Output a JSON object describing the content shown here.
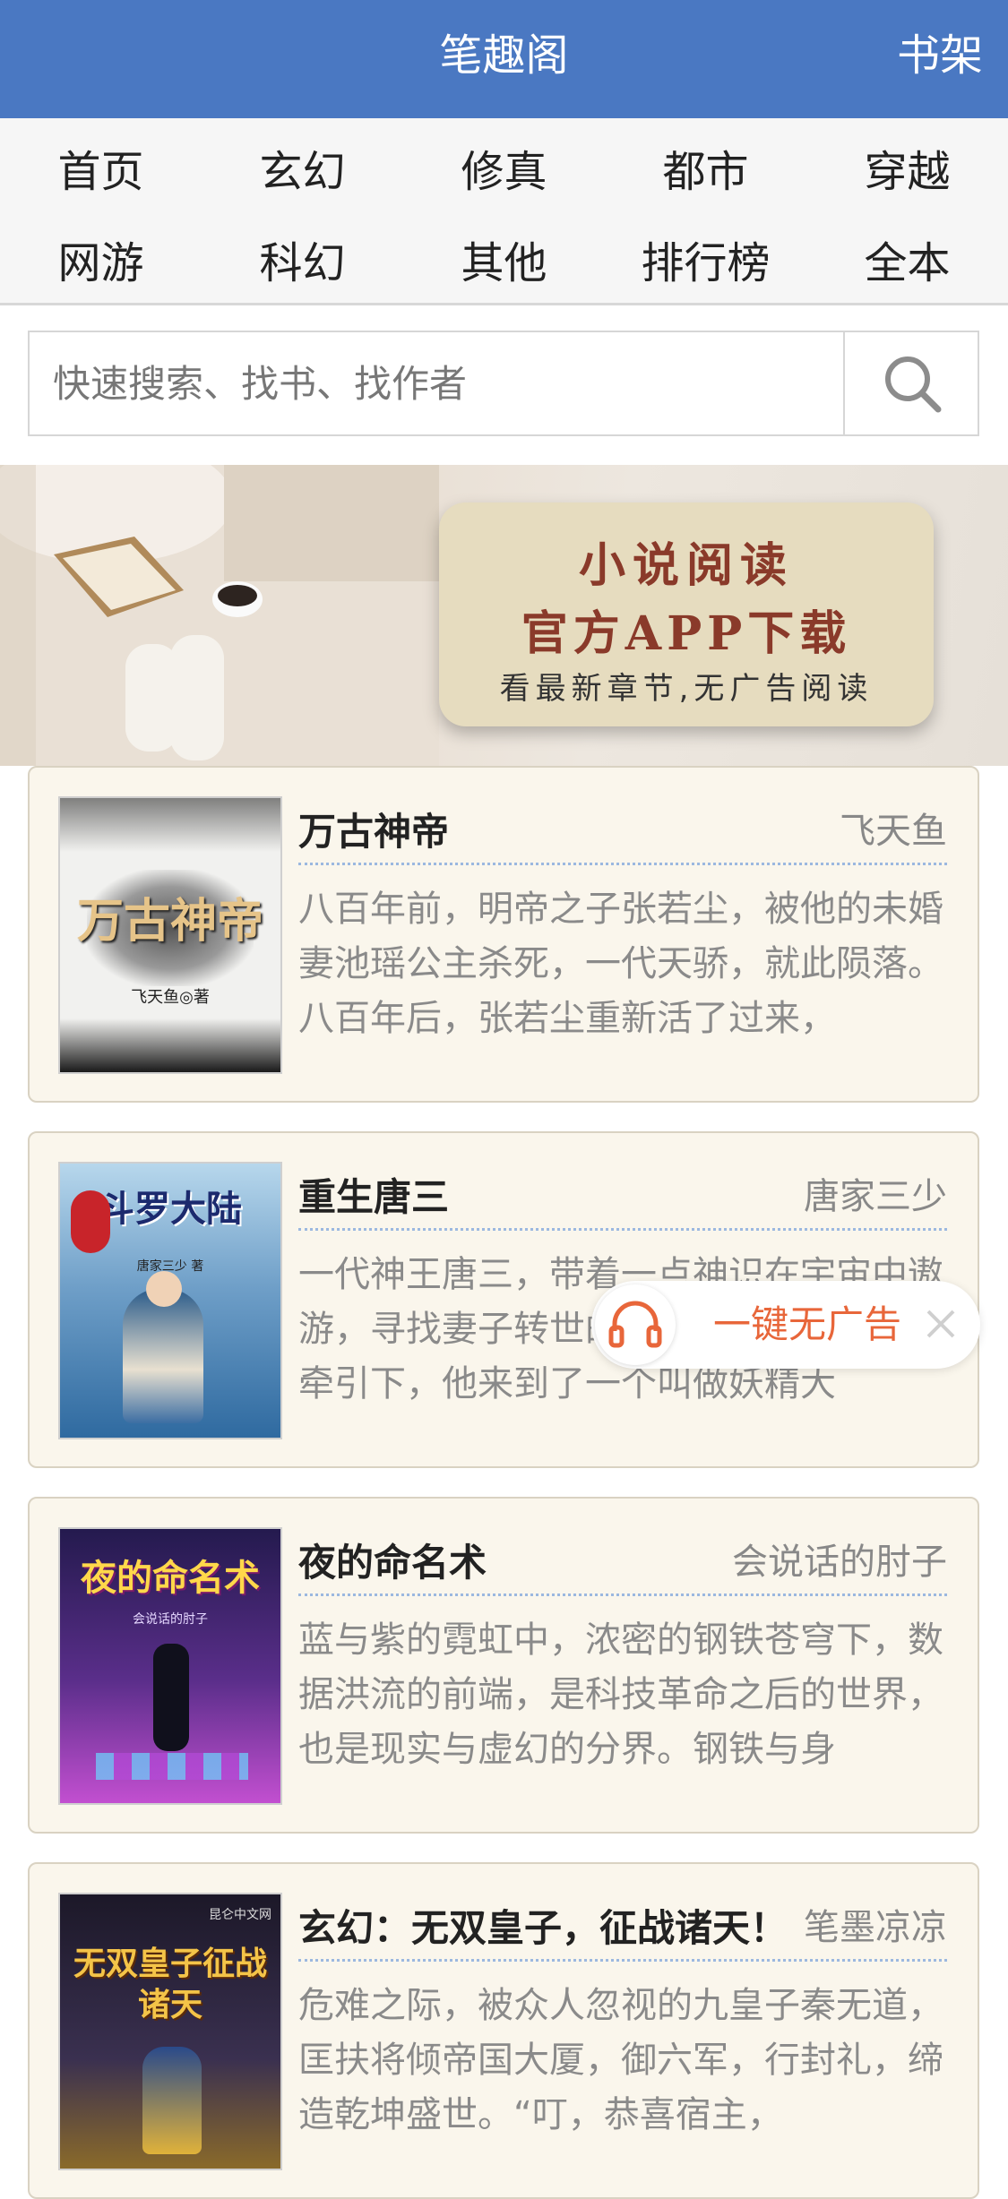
{
  "header": {
    "title": "笔趣阁",
    "bookshelf": "书架"
  },
  "nav": {
    "row1": [
      "首页",
      "玄幻",
      "修真",
      "都市",
      "穿越"
    ],
    "row2": [
      "网游",
      "科幻",
      "其他",
      "排行榜",
      "全本"
    ]
  },
  "search": {
    "placeholder": "快速搜索、找书、找作者",
    "icon": "search-icon"
  },
  "banner": {
    "line1": "小说阅读",
    "line2": "官方APP下载",
    "line3": "看最新章节,无广告阅读"
  },
  "books": [
    {
      "title": "万古神帝",
      "author": "飞天鱼",
      "desc": "八百年前，明帝之子张若尘，被他的未婚妻池瑶公主杀死，一代天骄，就此陨落。八百年后，张若尘重新活了过来，",
      "cover_title": "万古神帝",
      "cover_author": "飞天鱼◎著",
      "cover_bg": "#f1f1ef"
    },
    {
      "title": "重生唐三",
      "author": "唐家三少",
      "desc": "一代神王唐三，带着一点神识在宇宙中遨游，寻找妻子转世的踪迹，在一点神识的牵引下，他来到了一个叫做妖精大",
      "cover_title": "斗罗大陆",
      "cover_author": "唐家三少 著",
      "cover_bg": "#8fb9d6"
    },
    {
      "title": "夜的命名术",
      "author": "会说话的肘子",
      "desc": "蓝与紫的霓虹中，浓密的钢铁苍穹下，数据洪流的前端，是科技革命之后的世界，也是现实与虚幻的分界。钢铁与身",
      "cover_title": "夜的命名术",
      "cover_author": "会说话的肘子",
      "cover_bg": "#3a2a6e"
    },
    {
      "title": "玄幻：无双皇子，征战诸天！",
      "author": "笔墨凉凉",
      "desc": "危难之际，被众人忽视的九皇子秦无道，匡扶将倾帝国大厦，御六军，行封礼，缔造乾坤盛世。“叮，恭喜宿主，",
      "cover_title": "无双皇子征战诸天",
      "cover_author": "昆仑中文网",
      "cover_bg": "#2a2238"
    }
  ],
  "float_ad": {
    "label": "一键无广告",
    "icon": "headphones-icon",
    "close_icon": "close-icon"
  },
  "colors": {
    "header": "#4a78c2",
    "card_bg": "#faf6ec",
    "accent": "#e8663a"
  }
}
